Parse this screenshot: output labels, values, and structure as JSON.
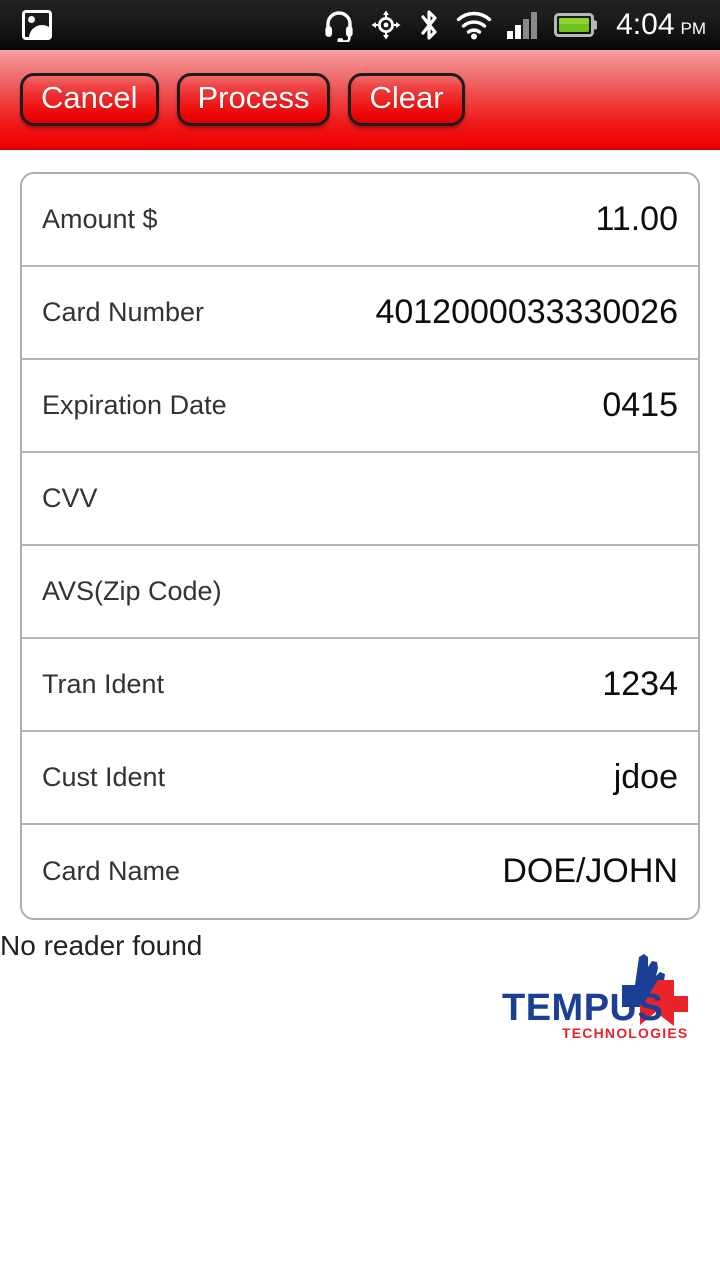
{
  "status_bar": {
    "left_icons": [
      {
        "name": "photo-icon",
        "label": "image"
      }
    ],
    "right_icons": [
      {
        "name": "headset-icon",
        "label": "headset"
      },
      {
        "name": "gps-icon",
        "label": "gps"
      },
      {
        "name": "bluetooth-icon",
        "label": "bluetooth"
      },
      {
        "name": "wifi-icon",
        "label": "wifi"
      },
      {
        "name": "signal-icon",
        "label": "signal",
        "bars_filled": 2,
        "bars_total": 4
      },
      {
        "name": "battery-icon",
        "label": "battery",
        "level": "full"
      }
    ],
    "time": "4:04",
    "meridiem": "PM"
  },
  "toolbar": {
    "cancel_label": "Cancel",
    "process_label": "Process",
    "clear_label": "Clear",
    "background_top": "#f4a4a4",
    "background_bottom": "#e80000"
  },
  "form": {
    "rows": [
      {
        "label": "Amount $",
        "value": "11.00"
      },
      {
        "label": "Card Number",
        "value": "4012000033330026"
      },
      {
        "label": "Expiration Date",
        "value": "0415"
      },
      {
        "label": "CVV",
        "value": ""
      },
      {
        "label": "AVS(Zip Code)",
        "value": ""
      },
      {
        "label": "Tran Ident",
        "value": "1234"
      },
      {
        "label": "Cust Ident",
        "value": "jdoe"
      },
      {
        "label": "Card Name",
        "value": "DOE/JOHN"
      }
    ]
  },
  "status_message": "No reader found",
  "logo": {
    "wordmark": "TEMPUS",
    "tagline": "TECHNOLOGIES",
    "blue": "#1b3f94",
    "red": "#e8242a"
  }
}
